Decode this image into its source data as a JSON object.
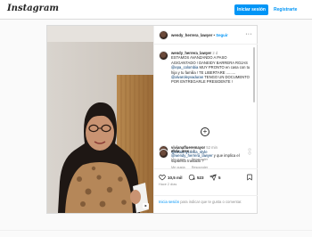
{
  "header": {
    "logo": "Instagram",
    "login_label": "Iniciar sesión",
    "signup_label": "Registrarte"
  },
  "post": {
    "username": "wendy_herrera_lawyer",
    "follow_label": "Seguir",
    "more_label": "···",
    "caption": {
      "username": "wendy_herrera_lawyer",
      "time": "2 d",
      "text": "ESTAMOS AVANZANDO A PASO AGIGANTADO ! DANEIDY BARRERA ROJAS",
      "tag1": "@epa_colombia",
      "text2": "MUY PRONTO en casa con tu hija y tu familia ! TE LIBERTARE .........",
      "tag2": "@alvaroleyvaduran",
      "text3": "TENGO UN DOCUMENTO POR ENTREGARLE PRESIDENTE !"
    },
    "load_more_icon": "plus-circle-icon",
    "comments": [
      {
        "username": "vivianaflueremayor",
        "time": "52 min",
        "mention": "@deisenycrellia_style",
        "text": "",
        "reply_label": "Responder",
        "likes_label": "Me gusta"
      },
      {
        "username": "elvia_ines",
        "time": "1 h",
        "mention": "@wendy_herrera_lawyer",
        "text": "y que implica el supuesto traslado ?",
        "reply_label": "Responder",
        "likes_label": "Me gusta"
      }
    ],
    "actions": {
      "likes": "10,5 mil",
      "comments": "523",
      "shares": "5"
    },
    "date": "Hace 2 días",
    "login_prompt_link": "Inicia sesión",
    "login_prompt_text": "para indicar que te gusta o comentar."
  },
  "colors": {
    "accent": "#0095f6",
    "border": "#dbdbdb",
    "muted": "#8e8e8e"
  }
}
